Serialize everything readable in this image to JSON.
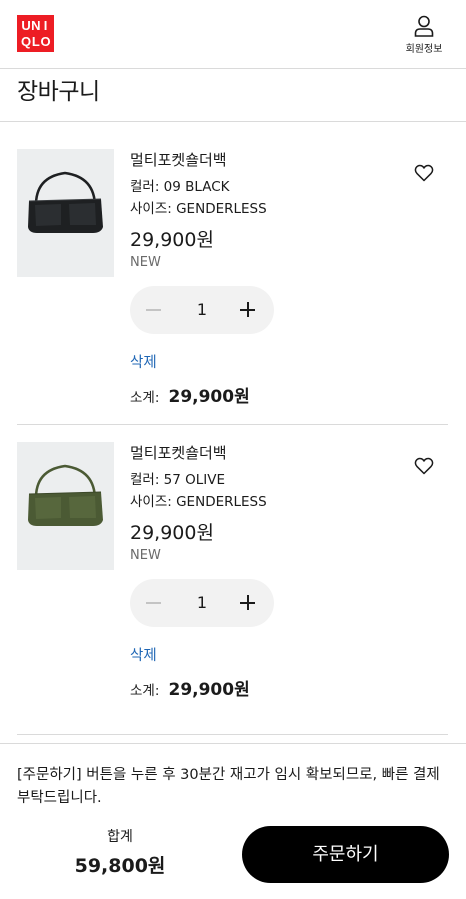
{
  "header": {
    "logo_letters": [
      "U",
      "N",
      "I",
      "Q",
      "L",
      "O"
    ],
    "member_label": "회원정보"
  },
  "page": {
    "title": "장바구니"
  },
  "cart": {
    "items": [
      {
        "name": "멀티포켓숄더백",
        "color": "컬러: 09 BLACK",
        "size": "사이즈: GENDERLESS",
        "price": "29,900원",
        "flag": "NEW",
        "quantity": "1",
        "delete_label": "삭제",
        "subtotal_label": "소계:",
        "subtotal_value": "29,900원",
        "bag_color": "#1e2022",
        "wish_icon": "heart-outline-icon"
      },
      {
        "name": "멀티포켓숄더백",
        "color": "컬러: 57 OLIVE",
        "size": "사이즈: GENDERLESS",
        "price": "29,900원",
        "flag": "NEW",
        "quantity": "1",
        "delete_label": "삭제",
        "subtotal_label": "소계:",
        "subtotal_value": "29,900원",
        "bag_color": "#4b5a34",
        "wish_icon": "heart-outline-icon"
      }
    ]
  },
  "footer": {
    "notice": "[주문하기] 버튼을 누른 후 30분간 재고가 임시 확보되므로, 빠른 결제 부탁드립니다.",
    "total_label": "합계",
    "total_value": "59,800원",
    "order_button": "주문하기"
  },
  "colors": {
    "brand_red": "#ed1d24",
    "link_blue": "#2067b5",
    "button_black": "#000000"
  }
}
